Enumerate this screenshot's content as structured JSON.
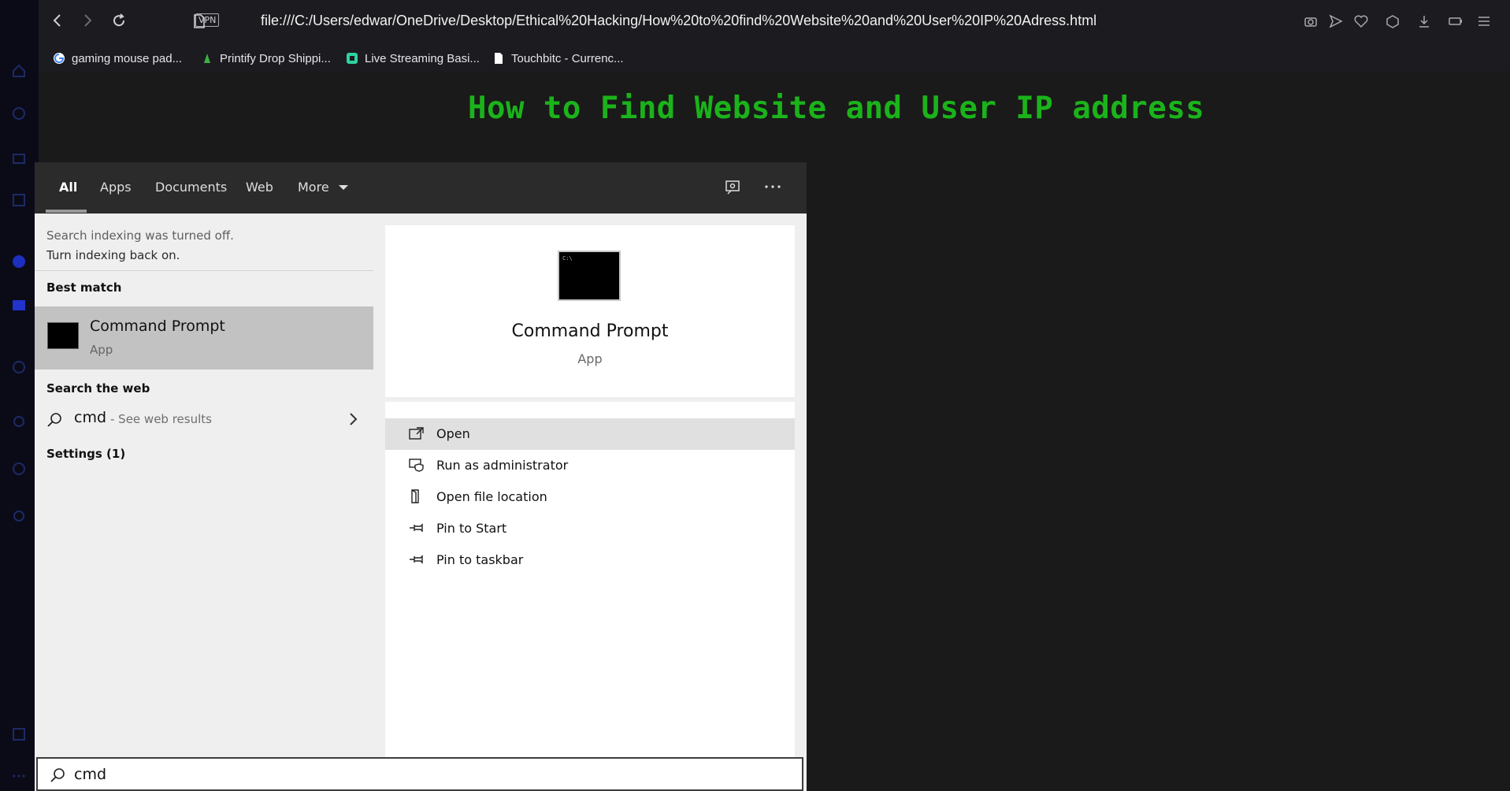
{
  "browser": {
    "vpn_label": "VPN",
    "address": "file:///C:/Users/edwar/OneDrive/Desktop/Ethical%20Hacking/How%20to%20find%20Website%20and%20User%20IP%20Adress.html",
    "bookmarks": [
      {
        "label": "gaming mouse pad...",
        "icon": "google-icon"
      },
      {
        "label": "Printify Drop Shippi...",
        "icon": "printify-icon"
      },
      {
        "label": "Live Streaming Basi...",
        "icon": "streaming-icon"
      },
      {
        "label": "Touchbitc - Currenc...",
        "icon": "page-icon"
      }
    ]
  },
  "page": {
    "title": "How to Find Website and User IP address",
    "title_color": "#1bb31b"
  },
  "search": {
    "tabs": [
      "All",
      "Apps",
      "Documents",
      "Web",
      "More"
    ],
    "active_tab": "All",
    "indexing_note": "Search indexing was turned off.",
    "indexing_link": "Turn indexing back on.",
    "best_match_heading": "Best match",
    "best_match": {
      "title": "Command Prompt",
      "subtitle": "App"
    },
    "web_heading": "Search the web",
    "web_query": "cmd",
    "web_hint": "- See web results",
    "settings_heading": "Settings (1)",
    "detail": {
      "title": "Command Prompt",
      "kind": "App"
    },
    "actions": [
      {
        "label": "Open",
        "icon": "open-icon"
      },
      {
        "label": "Run as administrator",
        "icon": "shield-icon"
      },
      {
        "label": "Open file location",
        "icon": "folder-icon"
      },
      {
        "label": "Pin to Start",
        "icon": "pin-icon"
      },
      {
        "label": "Pin to taskbar",
        "icon": "pin-icon"
      }
    ],
    "query": "cmd"
  }
}
